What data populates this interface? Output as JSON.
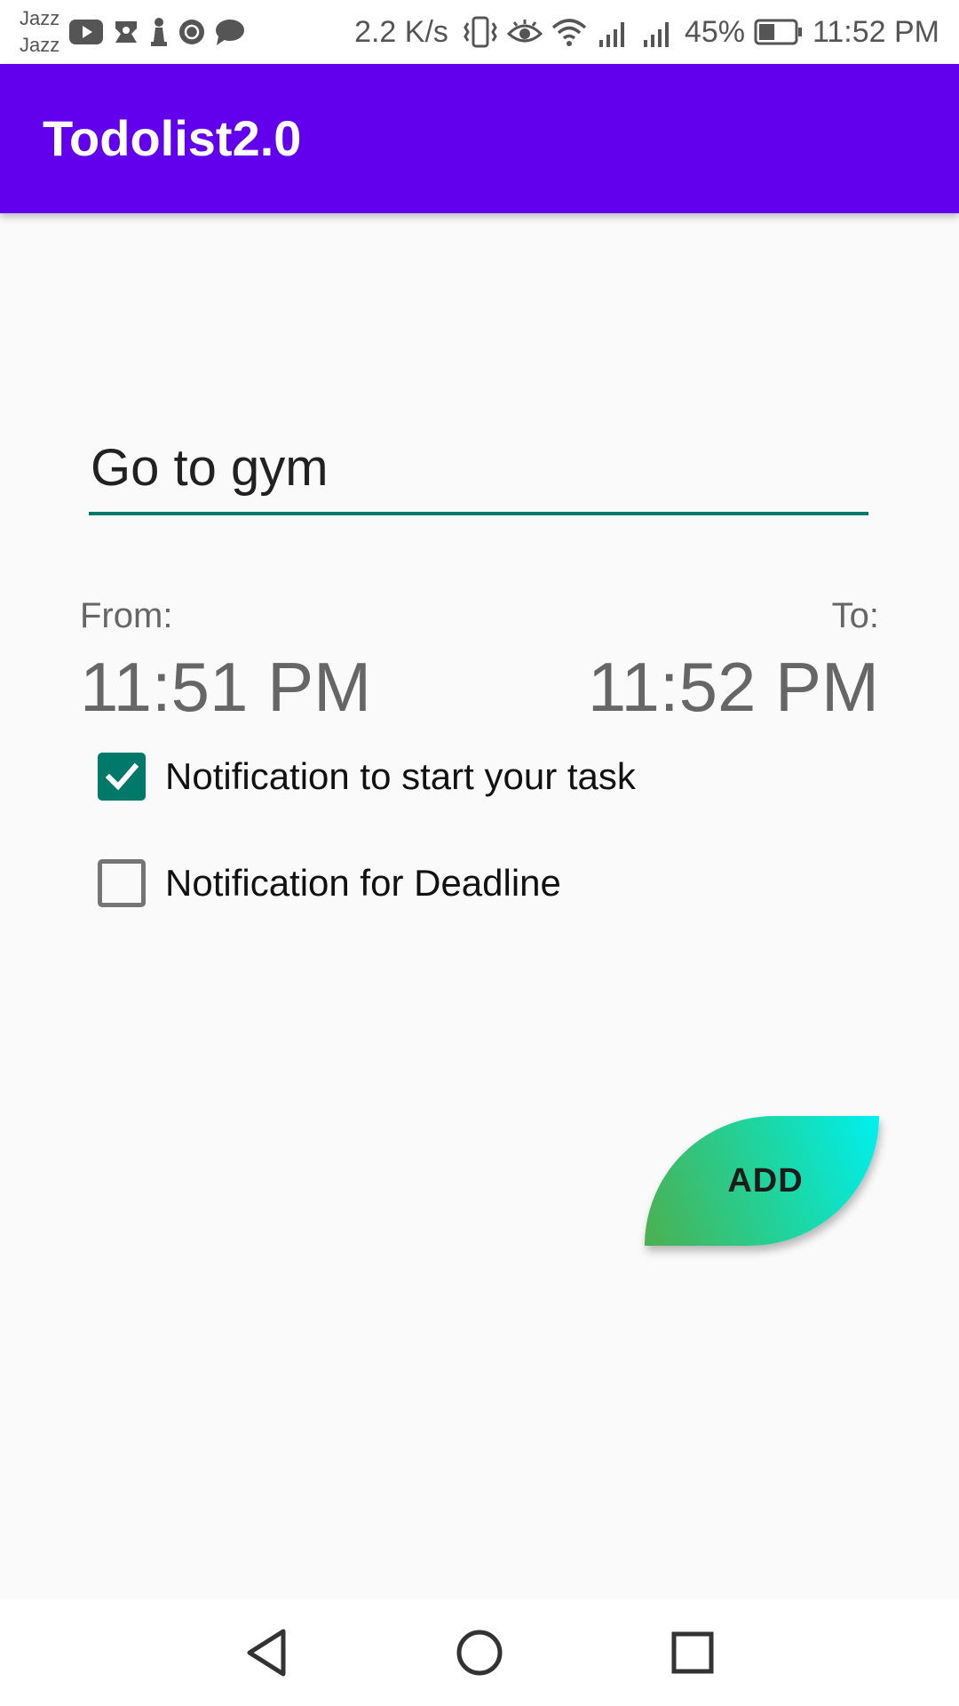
{
  "status_bar": {
    "carrier_line1": "Jazz",
    "carrier_line2": "Jazz",
    "speed": "2.2 K/s",
    "battery_percent": "45%",
    "battery_level": 0.45,
    "time": "11:52 PM",
    "icons_left": [
      "youtube-icon",
      "app-notification-icon",
      "chess-icon",
      "settings-badge-icon",
      "chat-icon"
    ],
    "icons_right": [
      "vibrate-icon",
      "eye-icon",
      "wifi-icon",
      "signal-icon",
      "signal-icon",
      "battery-icon"
    ]
  },
  "app_bar": {
    "title": "Todolist2.0",
    "color": "#6200ee"
  },
  "form": {
    "task_value": "Go to gym",
    "task_placeholder": "",
    "from_label": "From:",
    "to_label": "To:",
    "from_time": "11:51 PM",
    "to_time": "11:52 PM",
    "accent_color": "#00796b",
    "options": [
      {
        "label": "Notification to start your task",
        "checked": true
      },
      {
        "label": "Notification for Deadline",
        "checked": false
      }
    ]
  },
  "add_button": {
    "label": "ADD"
  },
  "nav_bar": {
    "buttons": [
      "back-icon",
      "home-icon",
      "recent-apps-icon"
    ]
  }
}
